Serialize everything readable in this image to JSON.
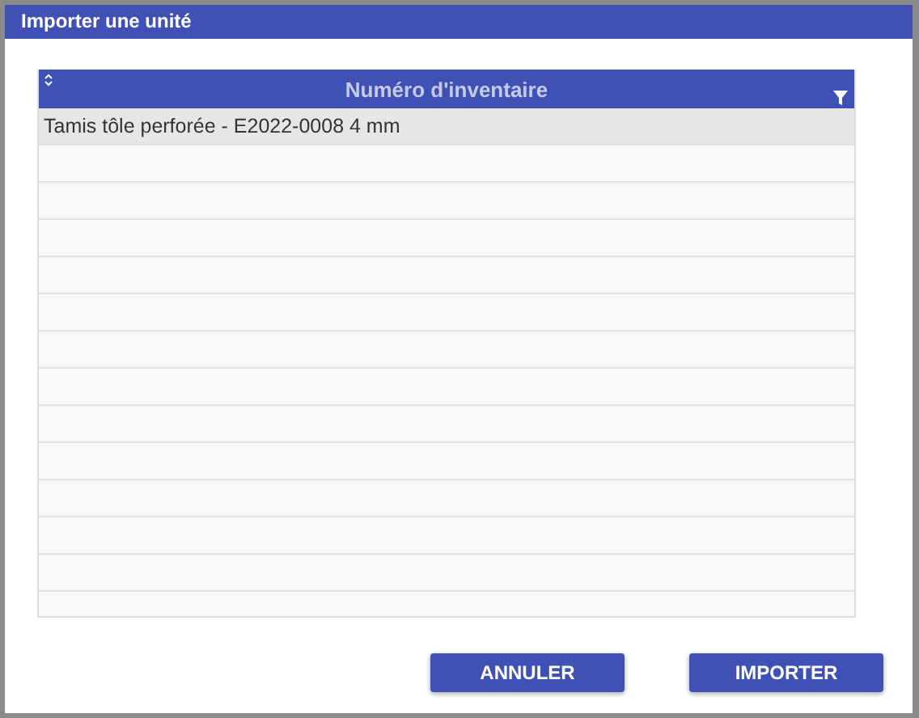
{
  "window": {
    "title": "Importer une unité"
  },
  "table": {
    "columns": [
      {
        "label": "Numéro d'inventaire"
      }
    ],
    "rows": [
      {
        "cells": [
          "Tamis tôle perforée - E2022-0008 4 mm"
        ],
        "selected": true
      }
    ]
  },
  "buttons": [
    {
      "label": "ANNULER"
    },
    {
      "label": "IMPORTER"
    }
  ]
}
